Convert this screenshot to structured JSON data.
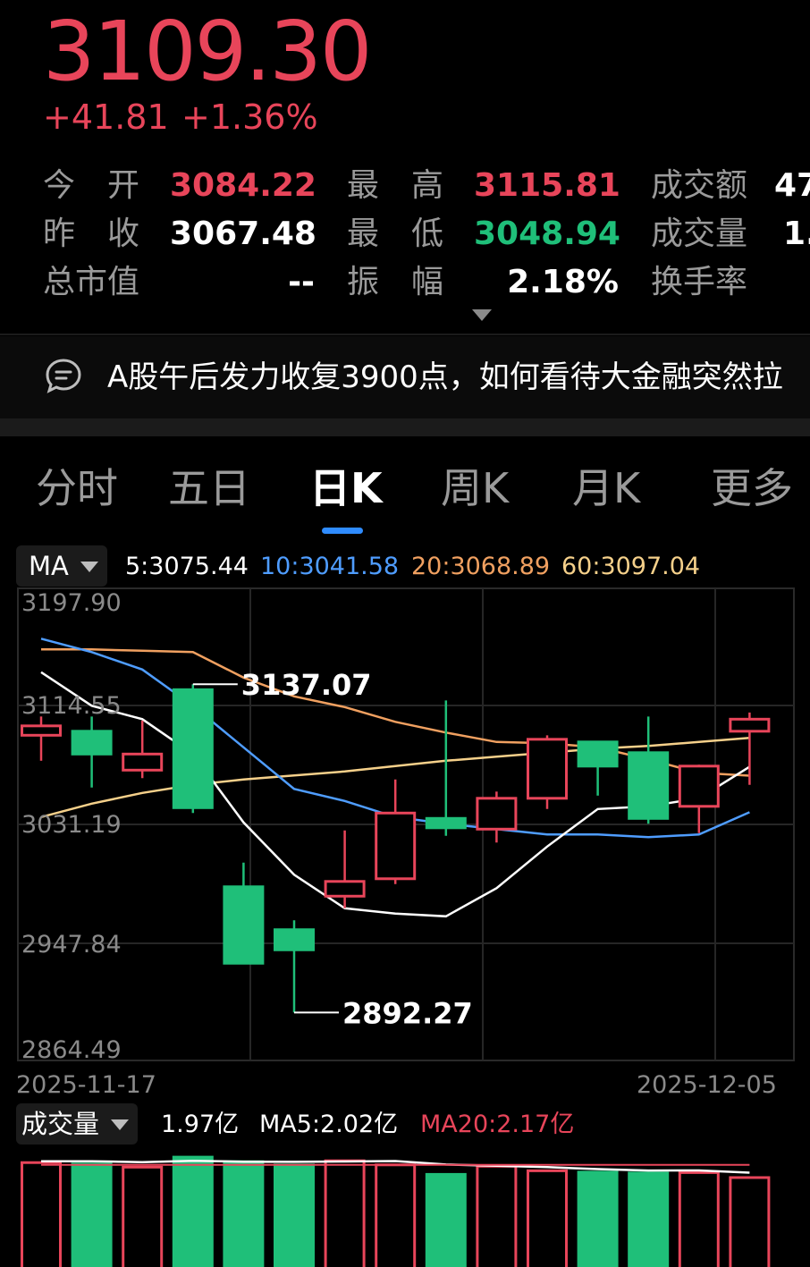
{
  "quote": {
    "price": "3109.30",
    "change": "+41.81",
    "change_pct": "+1.36%"
  },
  "stats": {
    "open_label": "今　开",
    "open_value": "3084.22",
    "high_label": "最　高",
    "high_value": "3115.81",
    "amount_label": "成交额",
    "amount_value": "47",
    "prev_close_label": "昨　收",
    "prev_close_value": "3067.48",
    "low_label": "最　低",
    "low_value": "3048.94",
    "volume_label": "成交量",
    "volume_value": "1.",
    "market_cap_label": "总市值",
    "market_cap_value": "--",
    "amplitude_label": "振　幅",
    "amplitude_value": "2.18%",
    "turnover_label": "换手率",
    "expand_icon": "caret-down-icon"
  },
  "news": {
    "icon": "chat-bubble-icon",
    "text": "A股午后发力收复3900点，如何看待大金融突然拉"
  },
  "tabs": [
    {
      "label": "分时"
    },
    {
      "label": "五日"
    },
    {
      "label": "日K",
      "active": true
    },
    {
      "label": "周K"
    },
    {
      "label": "月K"
    },
    {
      "label": "更多"
    }
  ],
  "ma_bar": {
    "selector": "MA",
    "ma5": "5:3075.44",
    "ma10": "10:3041.58",
    "ma20": "20:3068.89",
    "ma60": "60:3097.04"
  },
  "colors": {
    "up": "#e8455a",
    "down": "#1fbf79",
    "ma5": "#ffffff",
    "ma10": "#4f9dff",
    "ma20": "#f0a060",
    "ma60": "#f5d08a"
  },
  "chart_data": {
    "type": "candlestick",
    "y_ticks": [
      "3197.90",
      "3114.55",
      "3031.19",
      "2947.84",
      "2864.49"
    ],
    "ylim": [
      2864.49,
      3197.9
    ],
    "x_start_label": "2025-11-17",
    "x_end_label": "2025-12-05",
    "max_label": "3137.07",
    "min_label": "2892.27",
    "candles": [
      {
        "o": 3099,
        "h": 3113,
        "l": 3080,
        "c": 3106
      },
      {
        "o": 3103,
        "h": 3113,
        "l": 3060,
        "c": 3084
      },
      {
        "o": 3073,
        "h": 3110,
        "l": 3067,
        "c": 3085
      },
      {
        "o": 3134,
        "h": 3137.07,
        "l": 3041,
        "c": 3044
      },
      {
        "o": 2987,
        "h": 3004,
        "l": 2947,
        "c": 2928
      },
      {
        "o": 2955,
        "h": 2961,
        "l": 2892.27,
        "c": 2938
      },
      {
        "o": 2979,
        "h": 3028,
        "l": 2970,
        "c": 2990
      },
      {
        "o": 2992,
        "h": 3066,
        "l": 2988,
        "c": 3041
      },
      {
        "o": 3038,
        "h": 3125,
        "l": 3024,
        "c": 3029
      },
      {
        "o": 3029,
        "h": 3057,
        "l": 3019,
        "c": 3052
      },
      {
        "o": 3052,
        "h": 3099,
        "l": 3044,
        "c": 3096
      },
      {
        "o": 3095,
        "h": 3093,
        "l": 3054,
        "c": 3075
      },
      {
        "o": 3087,
        "h": 3113,
        "l": 3033,
        "c": 3036
      },
      {
        "o": 3046,
        "h": 3077,
        "l": 3026,
        "c": 3076
      },
      {
        "o": 3102,
        "h": 3116,
        "l": 3062,
        "c": 3111
      }
    ],
    "ma5": [
      3146,
      3121,
      3111,
      3085,
      3034,
      2995,
      2970,
      2966,
      2964,
      2985,
      3016,
      3044,
      3046,
      3052,
      3075.44
    ],
    "ma10": [
      3171,
      3161,
      3148,
      3121,
      3090,
      3059,
      3050,
      3038,
      3033,
      3029,
      3025,
      3025,
      3023,
      3025,
      3041.58
    ],
    "ma20": [
      3163,
      3163,
      3162,
      3161,
      3142,
      3128,
      3120,
      3109,
      3101,
      3094,
      3093,
      3090,
      3081,
      3071,
      3068.89
    ],
    "ma60": [
      3038,
      3048,
      3056,
      3062,
      3066,
      3069,
      3072,
      3076,
      3080,
      3083,
      3086,
      3089,
      3091,
      3094,
      3097.04
    ]
  },
  "volume_bar": {
    "selector": "成交量",
    "current": "1.97亿",
    "ma5": "MA5:2.02亿",
    "ma20": "MA20:2.17亿"
  },
  "volume_data": {
    "unit": "亿",
    "values": [
      2.3,
      2.45,
      2.3,
      2.3,
      2.2,
      2.45,
      2.35,
      2.28,
      2.34,
      2.25,
      2.07,
      2.22,
      2.12,
      2.12,
      2.1,
      2.08,
      1.97
    ]
  }
}
